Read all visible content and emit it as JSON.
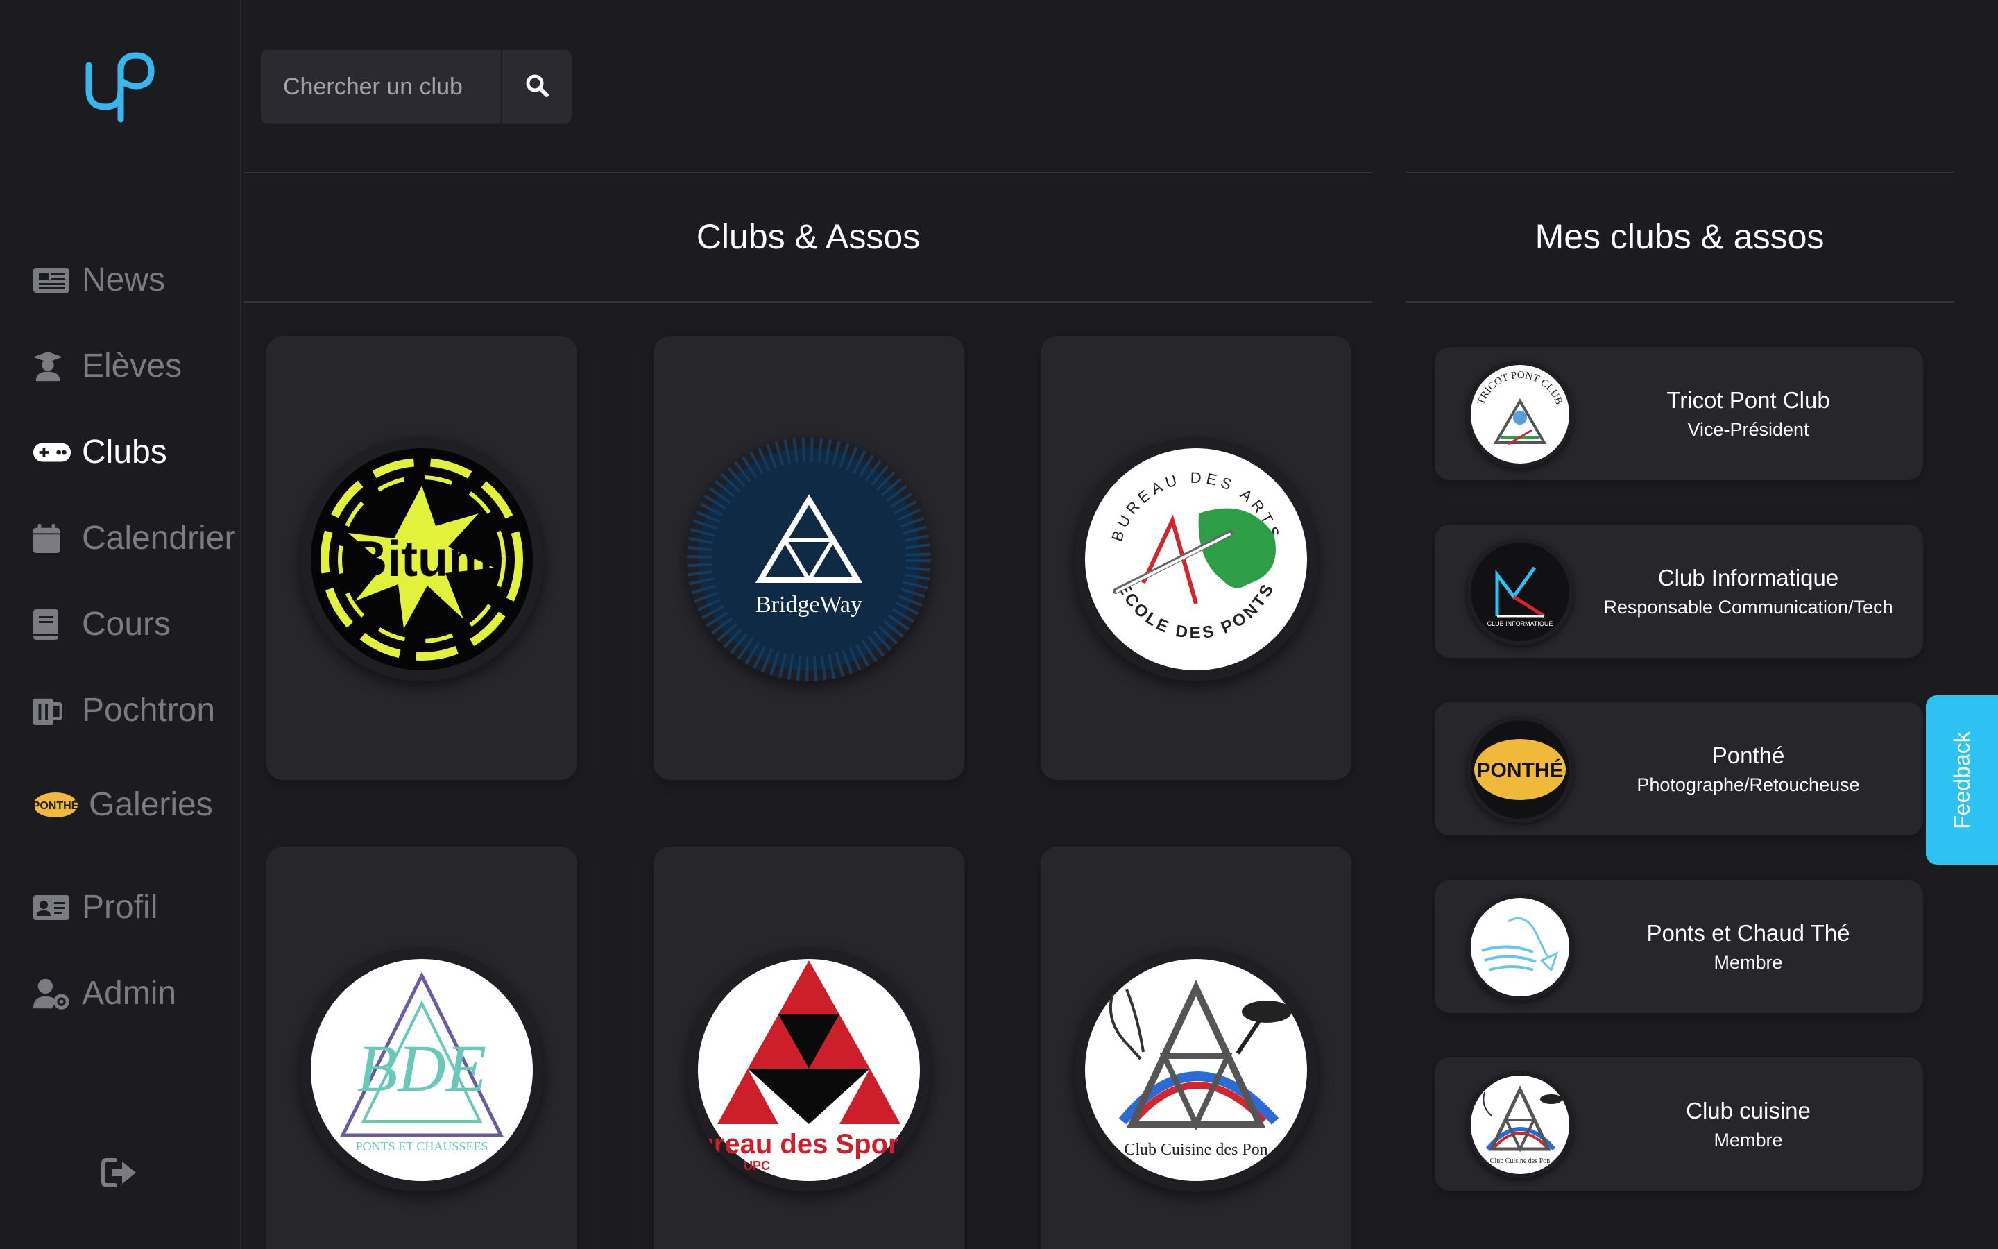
{
  "sidebar": {
    "items": [
      {
        "label": "News",
        "icon": "newspaper-icon"
      },
      {
        "label": "Elèves",
        "icon": "graduate-icon"
      },
      {
        "label": "Clubs",
        "icon": "gamepad-icon"
      },
      {
        "label": "Calendrier",
        "icon": "calendar-icon"
      },
      {
        "label": "Cours",
        "icon": "book-icon"
      },
      {
        "label": "Pochtron",
        "icon": "beer-mug-icon"
      },
      {
        "label": "Galeries",
        "icon": "ponthe-logo-icon"
      },
      {
        "label": "Profil",
        "icon": "id-card-icon"
      },
      {
        "label": "Admin",
        "icon": "user-cog-icon"
      }
    ],
    "active": "Clubs",
    "logout_icon": "sign-out-icon"
  },
  "search": {
    "placeholder": "Chercher un club",
    "button_icon": "search-icon"
  },
  "clubs_section": {
    "title": "Clubs & Assos",
    "cards": [
      {
        "name": "Bitum",
        "logo_text": "Bitum"
      },
      {
        "name": "BridgeWay",
        "logo_text": "BridgeWay"
      },
      {
        "name": "Bureau des Arts",
        "logo_text_top": "BUREAU DES ARTS",
        "logo_text_bottom": "ECOLE DES PONTS"
      },
      {
        "name": "BDE",
        "logo_text": "BDE",
        "logo_subtext": "PONTS ET CHAUSSEES"
      },
      {
        "name": "Bureau des Sports",
        "logo_text": "ureau des Spor",
        "logo_subtext": "UPC"
      },
      {
        "name": "Club Cuisine des Ponts",
        "logo_text": "Club Cuisine des Pon"
      }
    ]
  },
  "my_clubs_section": {
    "title": "Mes clubs & assos",
    "items": [
      {
        "name": "Tricot Pont Club",
        "role": "Vice-Président",
        "logo_text": "TRICOT PONT CLUB"
      },
      {
        "name": "Club Informatique",
        "role": "Responsable Communication/Tech",
        "logo_text": "CLUB INFORMATIQUE"
      },
      {
        "name": "Ponthé",
        "role": "Photographe/Retoucheuse",
        "logo_text": "PONTHÉ"
      },
      {
        "name": "Ponts et Chaud Thé",
        "role": "Membre"
      },
      {
        "name": "Club cuisine",
        "role": "Membre",
        "logo_text": "Club Cuisine des Pon"
      }
    ]
  },
  "feedback": {
    "label": "Feedback"
  },
  "colors": {
    "background": "#1c1c20",
    "card": "#26262b",
    "accent": "#2ec2f3",
    "logo_blue": "#3ab6ee",
    "muted": "#7b7b84"
  }
}
